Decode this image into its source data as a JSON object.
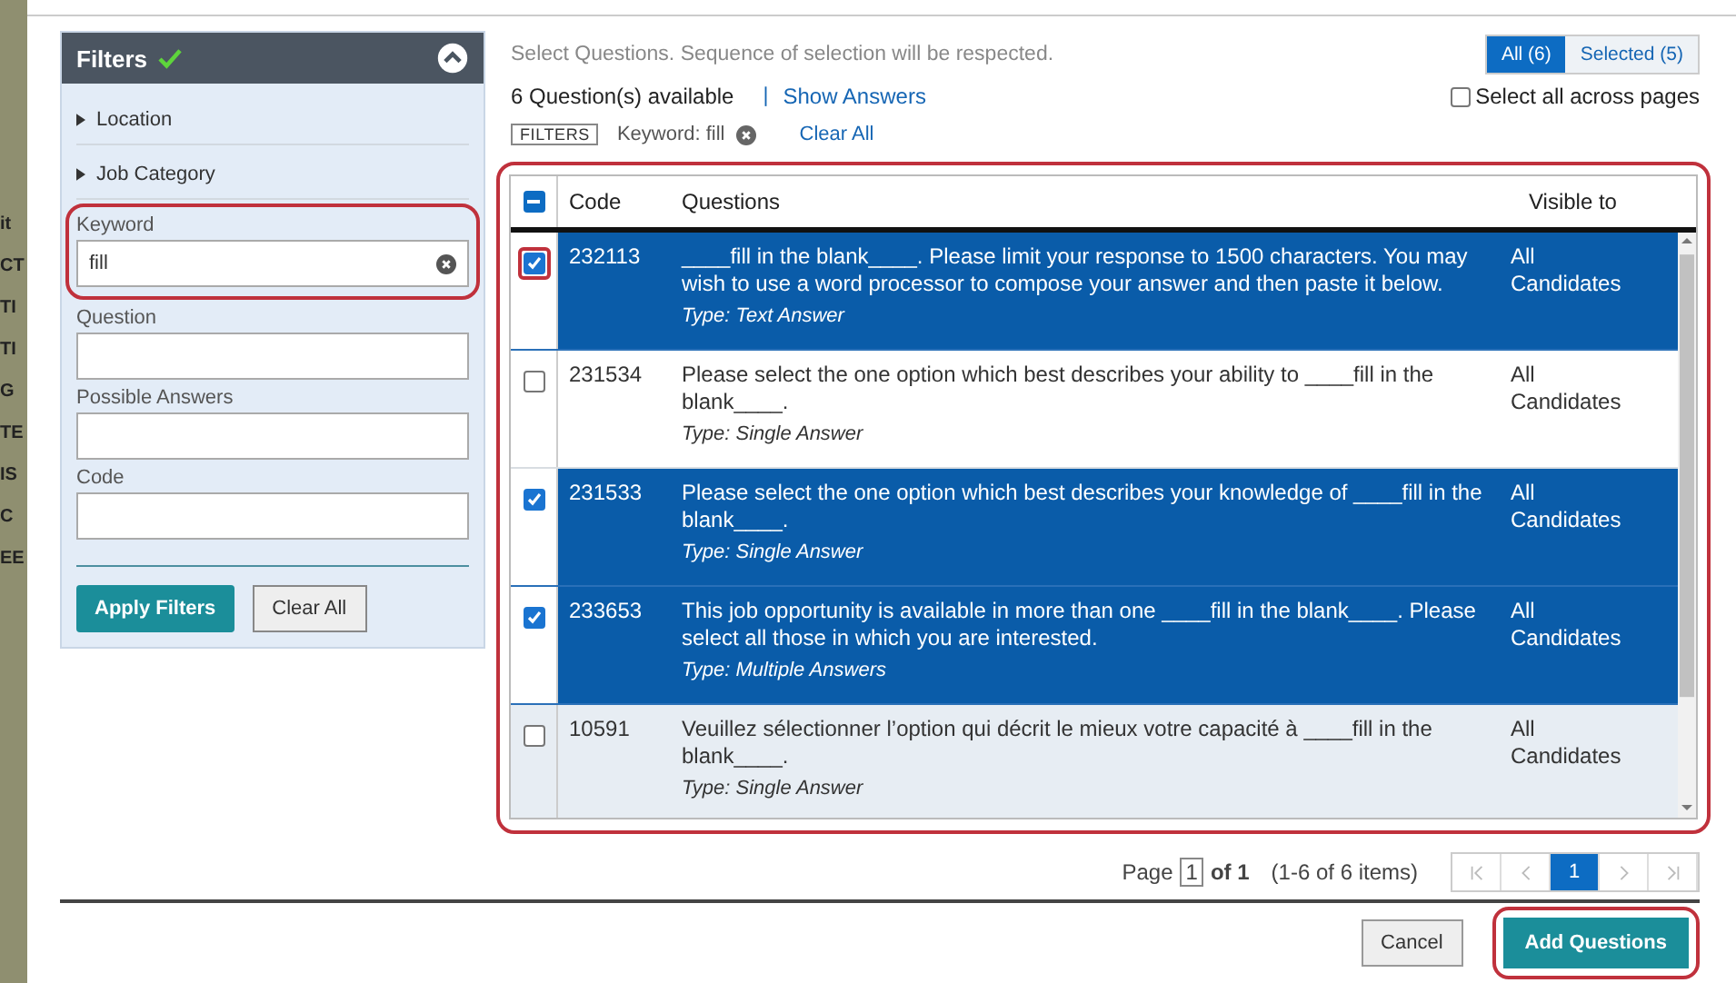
{
  "backdrop_fragments": [
    "it",
    "CT",
    "TI",
    "TI",
    "G",
    "TE",
    "IS",
    "C",
    "EE"
  ],
  "filters": {
    "title": "Filters",
    "applied": true,
    "expanded": true,
    "sections": [
      {
        "label": "Location",
        "expanded": false
      },
      {
        "label": "Job Category",
        "expanded": false
      }
    ],
    "fields": [
      {
        "label": "Keyword",
        "value": "fill",
        "highlighted": true
      },
      {
        "label": "Question"
      },
      {
        "label": "Possible Answers"
      },
      {
        "label": "Code"
      }
    ],
    "buttons": [
      "Apply Filters",
      "Clear All"
    ]
  },
  "instruction": "Select Questions. Sequence of selection will be respected.",
  "view_tabs": [
    {
      "label": "All (6)",
      "selected": true
    },
    {
      "label": "Selected (5)",
      "selected": false
    }
  ],
  "available": "6 Question(s) available",
  "separator": "|",
  "show_answers": "Show Answers",
  "select_all": {
    "label": "Select all across pages",
    "checked": false
  },
  "active_filters": {
    "tag": "FILTERS",
    "chip": "Keyword: fill",
    "clear": "Clear All"
  },
  "table": {
    "highlighted": true,
    "header_partial": true,
    "columns": [
      "Code",
      "Questions",
      "Visible to"
    ],
    "rows": [
      {
        "code": "232113",
        "question": "____fill in the blank____. Please limit your response to 1500 characters. You may wish to use a word processor to compose your answer and then paste it below.",
        "type": "Type: Text Answer",
        "visible": "All Candidates",
        "selected": true,
        "highlighted": true
      },
      {
        "code": "231534",
        "question": "Please select the one option which best describes your ability to ____fill in the blank____.",
        "type": "Type: Single Answer",
        "visible": "All Candidates",
        "selected": false,
        "highlighted": false
      },
      {
        "code": "231533",
        "question": "Please select the one option which best describes your knowledge of ____fill in the blank____.",
        "type": "Type: Single Answer",
        "visible": "All Candidates",
        "selected": true,
        "highlighted": false
      },
      {
        "code": "233653",
        "question": "This job opportunity is available in more than one ____fill in the blank____. Please select all those in which you are interested.",
        "type": "Type: Multiple Answers",
        "visible": "All Candidates",
        "selected": true,
        "highlighted": false
      },
      {
        "code": "10591",
        "question": "Veuillez sélectionner l’option qui décrit le mieux votre capacité à ____fill in the blank____.",
        "type": "Type: Single Answer",
        "visible": "All Candidates",
        "selected": false,
        "highlighted": false
      }
    ]
  },
  "pager": {
    "page_label": "Page",
    "page": "1",
    "of": "of 1",
    "range": "(1-6 of 6 items)",
    "pages": [
      {
        "label": "1",
        "selected": true
      }
    ]
  },
  "footer": [
    {
      "label": "Cancel",
      "kind": "secondary",
      "highlighted": false
    },
    {
      "label": "Add Questions",
      "kind": "primary",
      "highlighted": true
    }
  ]
}
